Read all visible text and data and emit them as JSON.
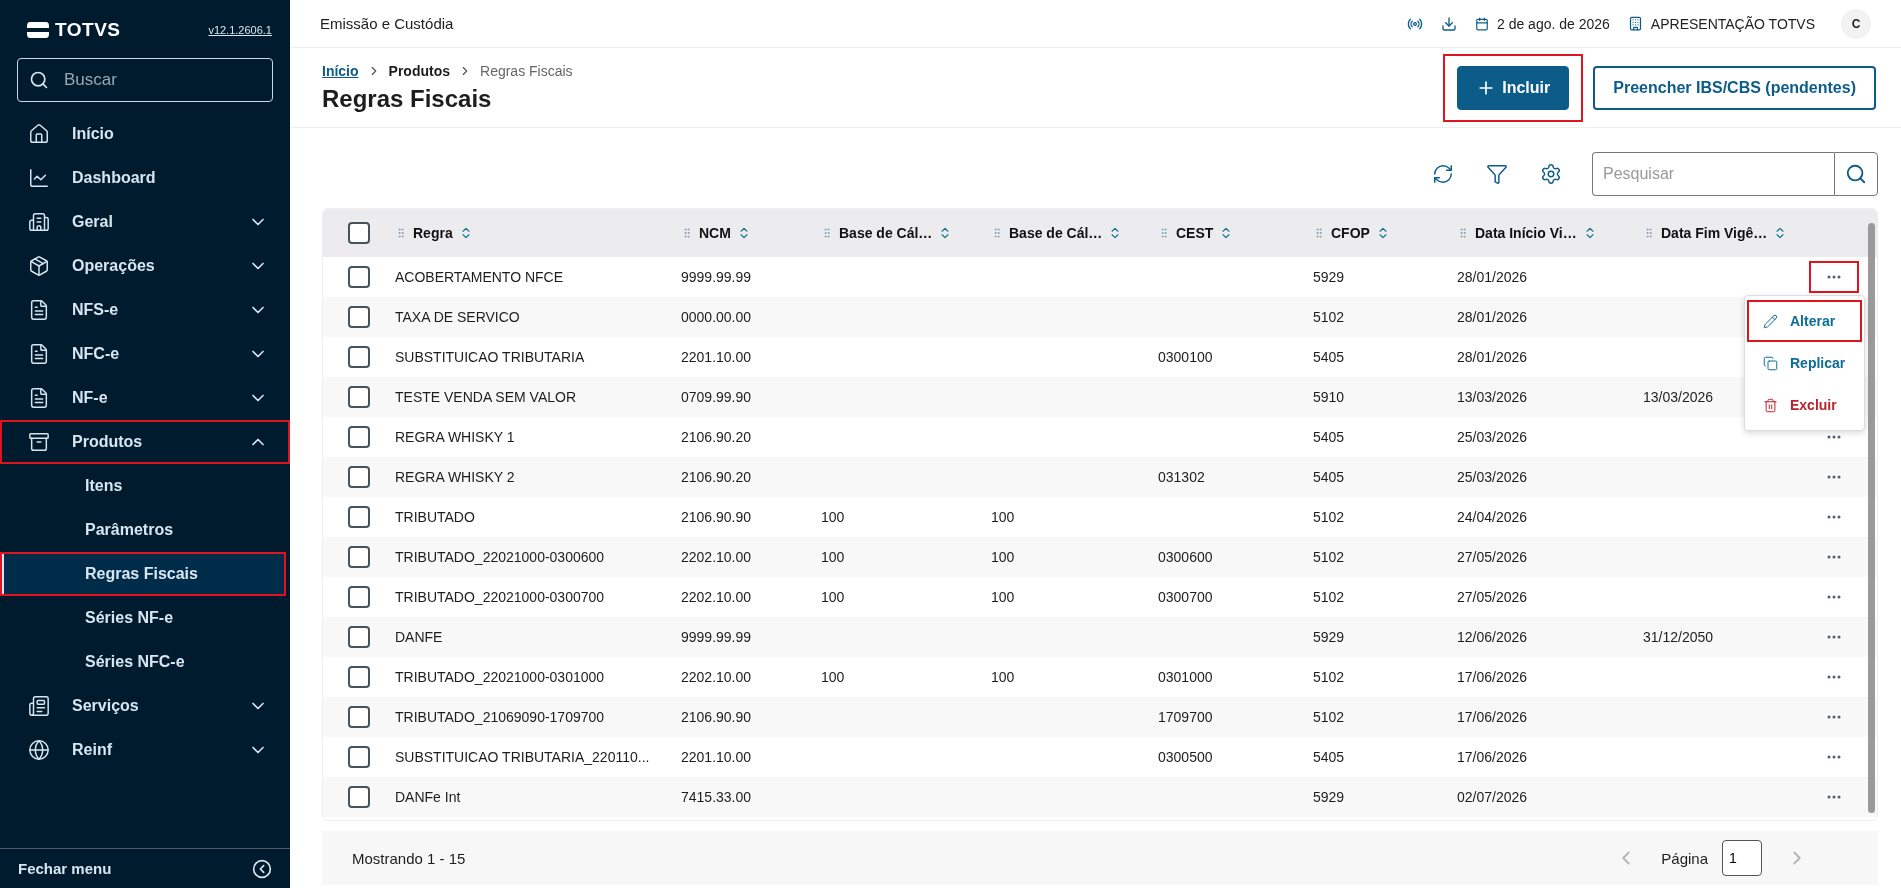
{
  "app": {
    "logo": "TOTVS",
    "version": "v12.1.2606.1"
  },
  "sidebar": {
    "search": {
      "placeholder": "Buscar"
    },
    "items": [
      {
        "label": "Início",
        "selected": false,
        "highlighted": false
      },
      {
        "label": "Dashboard",
        "selected": false,
        "highlighted": false
      },
      {
        "label": "Geral",
        "selected": false,
        "highlighted": false,
        "expanded": false
      },
      {
        "label": "Operações",
        "selected": false,
        "highlighted": false,
        "expanded": false
      },
      {
        "label": "NFS-e",
        "selected": false,
        "highlighted": false,
        "expanded": false
      },
      {
        "label": "NFC-e",
        "selected": false,
        "highlighted": false,
        "expanded": false
      },
      {
        "label": "NF-e",
        "selected": false,
        "highlighted": false,
        "expanded": false
      },
      {
        "label": "Produtos",
        "selected": false,
        "highlighted": true,
        "expanded": true,
        "children": [
          {
            "label": "Itens",
            "selected": false,
            "highlighted": false
          },
          {
            "label": "Parâmetros",
            "selected": false,
            "highlighted": false
          },
          {
            "label": "Regras Fiscais",
            "selected": true,
            "highlighted": true
          },
          {
            "label": "Séries NF-e",
            "selected": false,
            "highlighted": false
          },
          {
            "label": "Séries NFC-e",
            "selected": false,
            "highlighted": false
          }
        ]
      },
      {
        "label": "Serviços",
        "selected": false,
        "highlighted": false,
        "expanded": false
      },
      {
        "label": "Reinf",
        "selected": false,
        "highlighted": false,
        "expanded": false
      }
    ],
    "footer": "Fechar menu"
  },
  "topbar": {
    "title": "Emissão e Custódia",
    "date": "2 de ago. de 2026",
    "company": "APRESENTAÇÃO TOTVS",
    "avatar": "C"
  },
  "page": {
    "breadcrumb": [
      {
        "label": "Início",
        "kind": "link"
      },
      {
        "label": "Produtos",
        "kind": "parent"
      },
      {
        "label": "Regras Fiscais",
        "kind": "current"
      }
    ],
    "title": "Regras Fiscais",
    "actions": [
      {
        "label": "Incluir",
        "kind": "primary",
        "highlighted": true
      },
      {
        "label": "Preencher IBS/CBS (pendentes)",
        "kind": "secondary",
        "highlighted": false
      }
    ]
  },
  "toolbar": {
    "search": {
      "placeholder": "Pesquisar"
    }
  },
  "table": {
    "select_all": {
      "checked": false
    },
    "columns": [
      "Regra",
      "NCM",
      "Base de Cál…",
      "Base de Cál…",
      "CEST",
      "CFOP",
      "Data Início Vi…",
      "Data Fim Vigê…"
    ],
    "rows": [
      {
        "cells": [
          "ACOBERTAMENTO NFCE",
          "9999.99.99",
          "",
          "",
          "",
          "5929",
          "28/01/2026",
          ""
        ],
        "checked": false,
        "menu_button": true,
        "menu_highlighted": true
      },
      {
        "cells": [
          "TAXA DE SERVICO",
          "0000.00.00",
          "",
          "",
          "",
          "5102",
          "28/01/2026",
          ""
        ],
        "checked": false,
        "menu_button": false
      },
      {
        "cells": [
          "SUBSTITUICAO TRIBUTARIA",
          "2201.10.00",
          "",
          "",
          "0300100",
          "5405",
          "28/01/2026",
          ""
        ],
        "checked": false,
        "menu_button": false
      },
      {
        "cells": [
          "TESTE VENDA SEM VALOR",
          "0709.99.90",
          "",
          "",
          "",
          "5910",
          "13/03/2026",
          "13/03/2026"
        ],
        "checked": false,
        "menu_button": false
      },
      {
        "cells": [
          "REGRA WHISKY 1",
          "2106.90.20",
          "",
          "",
          "",
          "5405",
          "25/03/2026",
          ""
        ],
        "checked": false,
        "menu_button": true,
        "menu_highlighted": false
      },
      {
        "cells": [
          "REGRA WHISKY 2",
          "2106.90.20",
          "",
          "",
          "031302",
          "5405",
          "25/03/2026",
          ""
        ],
        "checked": false,
        "menu_button": true,
        "menu_highlighted": false
      },
      {
        "cells": [
          "TRIBUTADO",
          "2106.90.90",
          "100",
          "100",
          "",
          "5102",
          "24/04/2026",
          ""
        ],
        "checked": false,
        "menu_button": true,
        "menu_highlighted": false
      },
      {
        "cells": [
          "TRIBUTADO_22021000-0300600",
          "2202.10.00",
          "100",
          "100",
          "0300600",
          "5102",
          "27/05/2026",
          ""
        ],
        "checked": false,
        "menu_button": true,
        "menu_highlighted": false
      },
      {
        "cells": [
          "TRIBUTADO_22021000-0300700",
          "2202.10.00",
          "100",
          "100",
          "0300700",
          "5102",
          "27/05/2026",
          ""
        ],
        "checked": false,
        "menu_button": true,
        "menu_highlighted": false
      },
      {
        "cells": [
          "DANFE",
          "9999.99.99",
          "",
          "",
          "",
          "5929",
          "12/06/2026",
          "31/12/2050"
        ],
        "checked": false,
        "menu_button": true,
        "menu_highlighted": false
      },
      {
        "cells": [
          "TRIBUTADO_22021000-0301000",
          "2202.10.00",
          "100",
          "100",
          "0301000",
          "5102",
          "17/06/2026",
          ""
        ],
        "checked": false,
        "menu_button": true,
        "menu_highlighted": false
      },
      {
        "cells": [
          "TRIBUTADO_21069090-1709700",
          "2106.90.90",
          "",
          "",
          "1709700",
          "5102",
          "17/06/2026",
          ""
        ],
        "checked": false,
        "menu_button": true,
        "menu_highlighted": false
      },
      {
        "cells": [
          "SUBSTITUICAO TRIBUTARIA_220110...",
          "2201.10.00",
          "",
          "",
          "0300500",
          "5405",
          "17/06/2026",
          ""
        ],
        "checked": false,
        "menu_button": true,
        "menu_highlighted": false
      },
      {
        "cells": [
          "DANFe Int",
          "7415.33.00",
          "",
          "",
          "",
          "5929",
          "02/07/2026",
          ""
        ],
        "checked": false,
        "menu_button": true,
        "menu_highlighted": false
      }
    ],
    "row_menu": {
      "items": [
        {
          "label": "Alterar",
          "kind": "edit",
          "highlighted": true
        },
        {
          "label": "Replicar",
          "kind": "copy",
          "highlighted": false
        },
        {
          "label": "Excluir",
          "kind": "delete",
          "highlighted": false
        }
      ]
    }
  },
  "footer": {
    "summary": "Mostrando 1 - 15",
    "page_label": "Página",
    "page": "1",
    "prev_disabled": true,
    "next_disabled": true
  }
}
